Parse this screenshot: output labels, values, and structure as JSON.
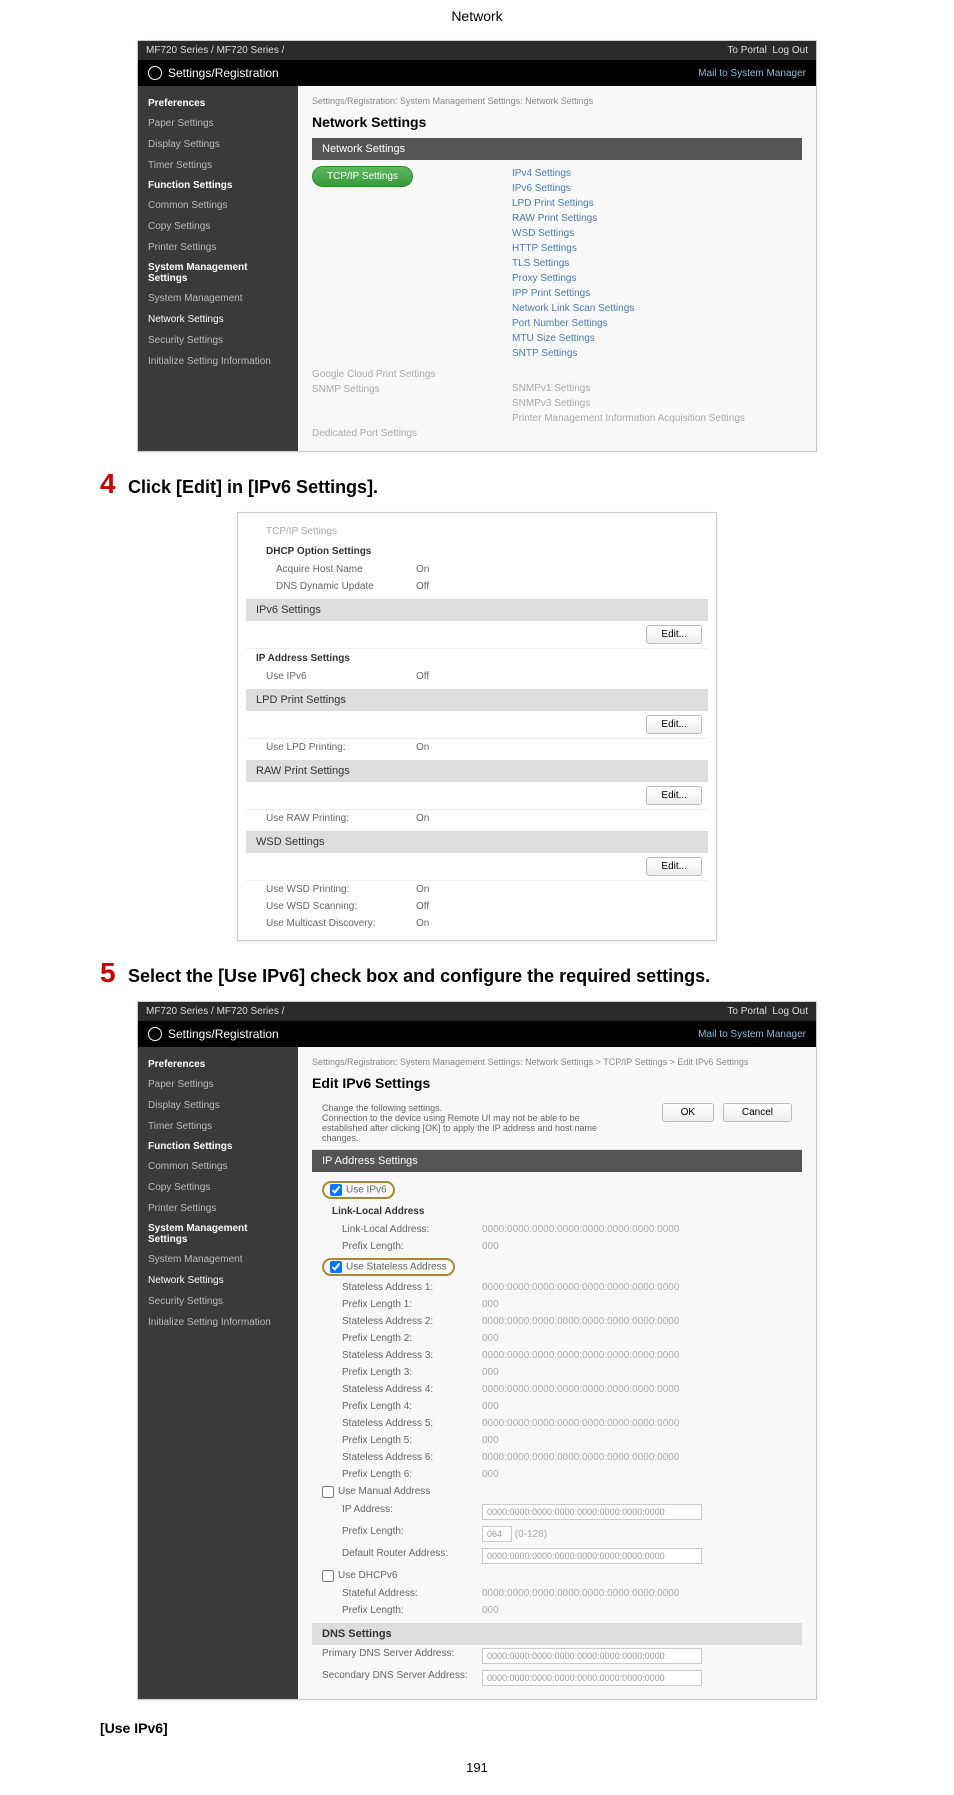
{
  "header": {
    "title": "Network"
  },
  "step4": {
    "number": "4",
    "text": "Click [Edit] in [IPv6 Settings]."
  },
  "step5": {
    "number": "5",
    "text": "Select the [Use IPv6] check box and configure the required settings."
  },
  "topbar": {
    "model": "MF720 Series / MF720 Series /",
    "portal": "To Portal",
    "logout": "Log Out"
  },
  "regbar": {
    "title": "Settings/Registration",
    "mail": "Mail to System Manager"
  },
  "sidebar": {
    "preferences": "Preferences",
    "paper": "Paper Settings",
    "display": "Display Settings",
    "timer": "Timer Settings",
    "function": "Function Settings",
    "common": "Common Settings",
    "copy": "Copy Settings",
    "printer": "Printer Settings",
    "sysmgmt": "System Management Settings",
    "sysmgmtitem": "System Management",
    "network": "Network Settings",
    "security": "Security Settings",
    "init": "Initialize Setting Information"
  },
  "panel1": {
    "breadcrumb": "Settings/Registration: System Management Settings: Network Settings",
    "title": "Network Settings",
    "section": "Network Settings",
    "tcpip_btn": "TCP/IP Settings",
    "links": {
      "ipv4": "IPv4 Settings",
      "ipv6": "IPv6 Settings",
      "lpd": "LPD Print Settings",
      "raw": "RAW Print Settings",
      "wsd": "WSD Settings",
      "http": "HTTP Settings",
      "tls": "TLS Settings",
      "proxy": "Proxy Settings",
      "ipp": "IPP Print Settings",
      "netlink": "Network Link Scan Settings",
      "portnum": "Port Number Settings",
      "mtu": "MTU Size Settings",
      "sntp": "SNTP Settings"
    },
    "google": "Google Cloud Print Settings",
    "snmp_label": "SNMP Settings",
    "snmpv1": "SNMPv1 Settings",
    "snmpv3": "SNMPv3 Settings",
    "pminfo": "Printer Management Information Acquisition Settings",
    "dedport": "Dedicated Port Settings"
  },
  "panel2": {
    "tcpip_small": "TCP/IP Settings",
    "dhcp_header": "DHCP Option Settings",
    "acquire": "Acquire Host Name",
    "acquire_val": "On",
    "dnsdyn": "DNS Dynamic Update",
    "dnsdyn_val": "Off",
    "ipv6_header": "IPv6 Settings",
    "edit_btn": "Edit...",
    "ipaddr_header": "IP Address Settings",
    "useipv6": "Use IPv6",
    "useipv6_val": "Off",
    "lpd_header": "LPD Print Settings",
    "uselpd": "Use LPD Printing:",
    "uselpd_val": "On",
    "raw_header": "RAW Print Settings",
    "useraw": "Use RAW Printing:",
    "useraw_val": "On",
    "wsd_header": "WSD Settings",
    "wsdprint": "Use WSD Printing:",
    "wsdprint_val": "On",
    "wsdscan": "Use WSD Scanning:",
    "wsdscan_val": "Off",
    "wsdmc": "Use Multicast Discovery:",
    "wsdmc_val": "On"
  },
  "panel3": {
    "breadcrumb": "Settings/Registration: System Management Settings: Network Settings > TCP/IP Settings > Edit IPv6 Settings",
    "title": "Edit IPv6 Settings",
    "note1": "Change the following settings.",
    "note2": "Connection to the device using Remote UI may not be able to be established after clicking [OK] to apply the IP address and host name changes.",
    "ok": "OK",
    "cancel": "Cancel",
    "ipaddr_header": "IP Address Settings",
    "useipv6": "Use IPv6",
    "linklocal_header": "Link-Local Address",
    "linklocal_addr": "Link-Local Address:",
    "prefix": "Prefix Length:",
    "addr_placeholder": "0000:0000:0000:0000:0000:0000:0000:0000",
    "prefix_placeholder": "000",
    "usestateless": "Use Stateless Address",
    "sa": "Stateless Address",
    "sa1": "Stateless Address 1:",
    "pl1": "Prefix Length 1:",
    "sa2": "Stateless Address 2:",
    "pl2": "Prefix Length 2:",
    "sa3": "Stateless Address 3:",
    "pl3": "Prefix Length 3:",
    "sa4": "Stateless Address 4:",
    "pl4": "Prefix Length 4:",
    "sa5": "Stateless Address 5:",
    "pl5": "Prefix Length 5:",
    "sa6": "Stateless Address 6:",
    "pl6": "Prefix Length 6:",
    "usemanual": "Use Manual Address",
    "ipaddr": "IP Address:",
    "prefix_len": "Prefix Length:",
    "prefix_val": "(0-128)",
    "defroute": "Default Router Address:",
    "usedhcp": "Use DHCPv6",
    "stateful": "Stateful Address:",
    "dns_header": "DNS Settings",
    "pridns": "Primary DNS Server Address:",
    "secdns": "Secondary DNS Server Address:"
  },
  "bottom": {
    "useipv6": "[Use IPv6]"
  },
  "pagenum": "191"
}
